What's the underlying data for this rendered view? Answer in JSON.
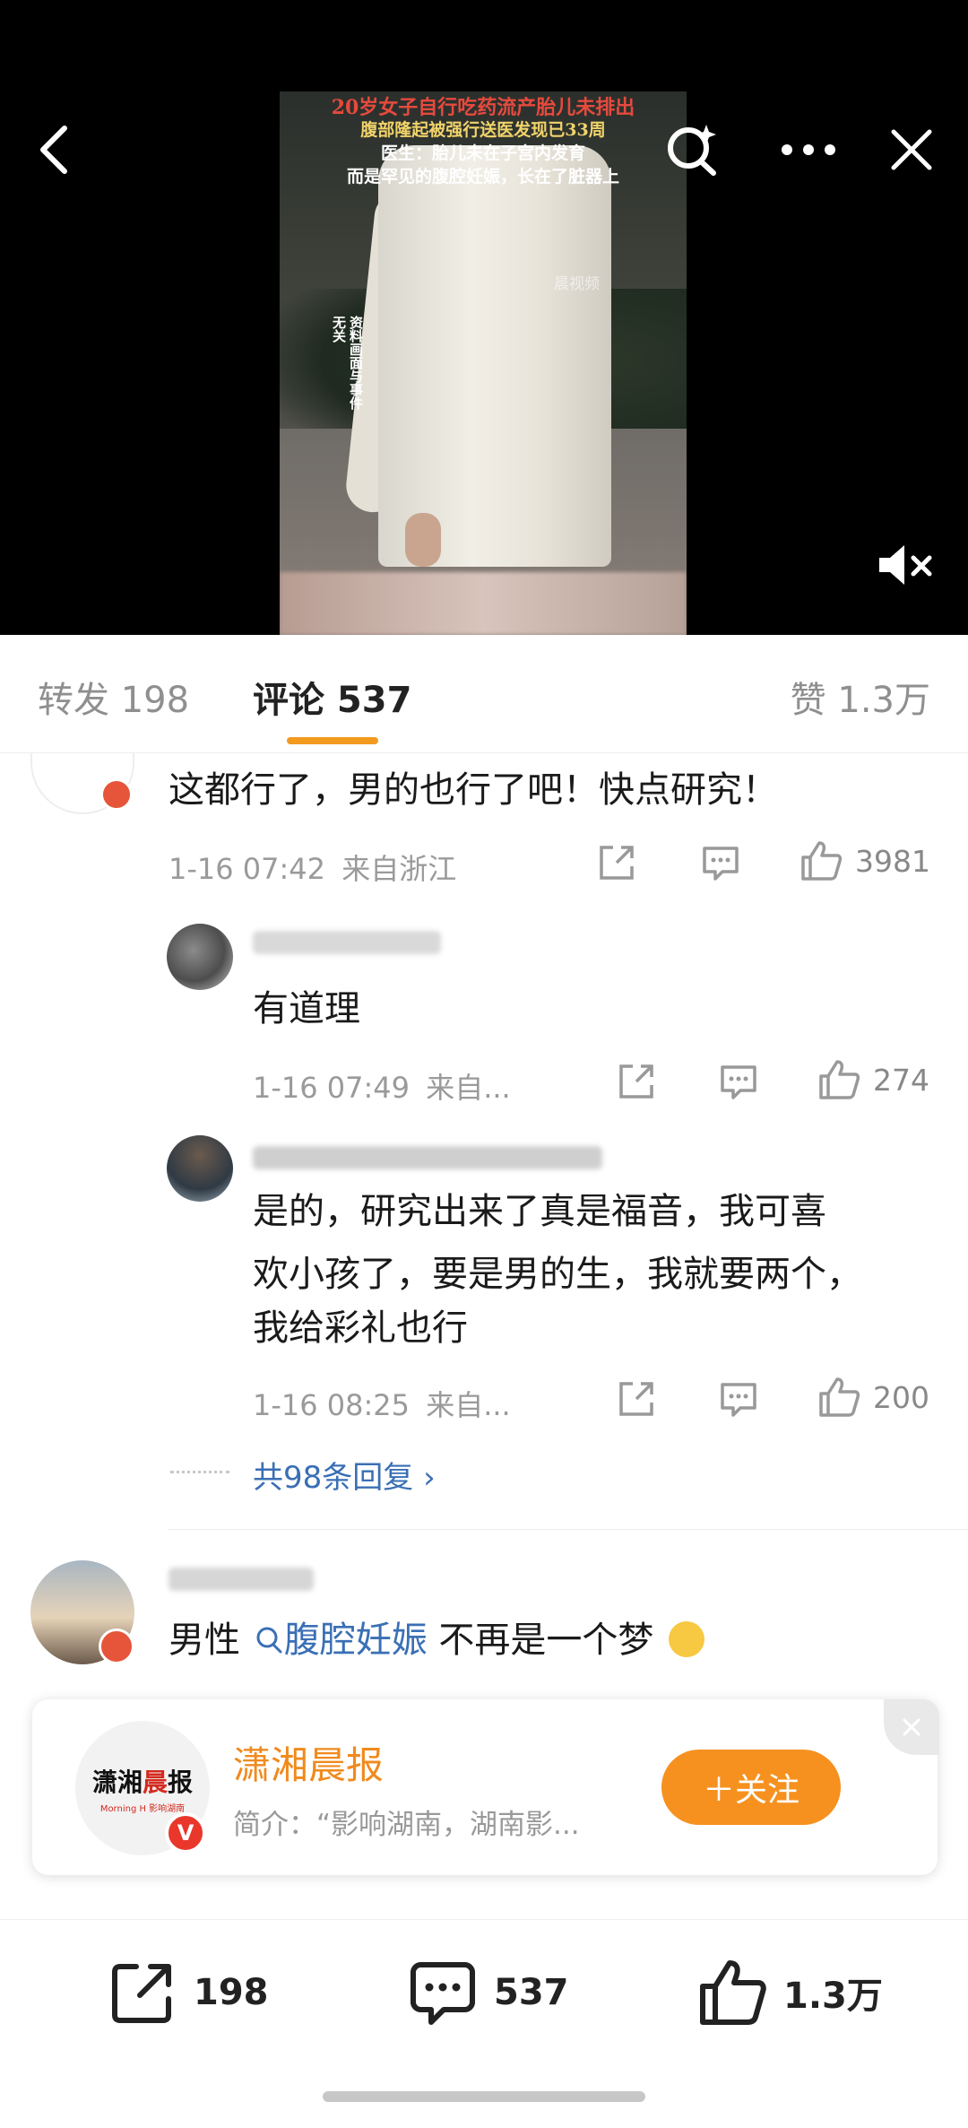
{
  "video": {
    "caption_lines": [
      "20岁女子自行吃药流产胎儿未排出",
      "腹部隆起被强行送医发现已33周",
      "医生：胎儿未在子宫内发育",
      "而是罕见的腹腔妊娠，长在了脏器上"
    ],
    "disclaimer": "资料画面与事件无关",
    "watermark": "晨视频"
  },
  "tabs": {
    "repost": "转发 198",
    "comment": "评论 537",
    "like": "赞 1.3万",
    "active": "comment",
    "accent_color": "#f29a1e"
  },
  "comments": [
    {
      "text": "这都行了，男的也行了吧！快点研究！",
      "time": "1-16 07:42",
      "location": "来自浙江",
      "likes": "3981"
    },
    {
      "text": "有道理",
      "time": "1-16 07:49",
      "location": "来自...",
      "likes": "274"
    },
    {
      "text_lines": [
        "是的，研究出来了真是福音，我可喜",
        "欢小孩了，要是男的生，我就要两个，",
        "我给彩礼也行"
      ],
      "time": "1-16 08:25",
      "location": "来自...",
      "likes": "200"
    }
  ],
  "reply_more": "共98条回复 ›",
  "comment4": {
    "prefix": "男性",
    "hashtag": "腹腔妊娠",
    "suffix": " 不再是一个梦"
  },
  "card": {
    "logo_text_a": "潇湘",
    "logo_text_b": "晨",
    "logo_text_c": "报",
    "logo_sub": "Morning H  影响湖南",
    "name": "潇湘晨报",
    "intro": "简介：“影响湖南，湖南影...",
    "follow": "＋关注"
  },
  "bottom": {
    "repost": "198",
    "comment": "537",
    "like": "1.3万"
  }
}
